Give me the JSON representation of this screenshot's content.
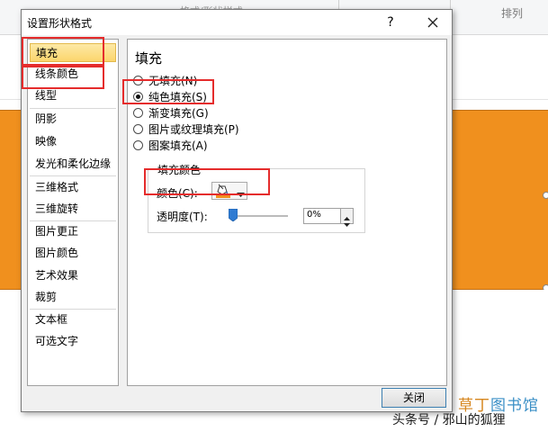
{
  "background": {
    "ribbon_faded_text": "格式/形状样式",
    "arrange_label": "排列",
    "shape_fill_color": "#f0901e"
  },
  "dialog": {
    "title": "设置形状格式",
    "help_label": "?",
    "close_icon": "close-icon",
    "close_button_label": "关闭"
  },
  "sidebar": {
    "items": [
      {
        "label": "填充",
        "selected": true
      },
      {
        "label": "线条颜色",
        "selected": false
      },
      {
        "label": "线型",
        "selected": false
      },
      {
        "label": "阴影",
        "selected": false
      },
      {
        "label": "映像",
        "selected": false
      },
      {
        "label": "发光和柔化边缘",
        "selected": false
      },
      {
        "label": "三维格式",
        "selected": false
      },
      {
        "label": "三维旋转",
        "selected": false
      },
      {
        "label": "图片更正",
        "selected": false
      },
      {
        "label": "图片颜色",
        "selected": false
      },
      {
        "label": "艺术效果",
        "selected": false
      },
      {
        "label": "裁剪",
        "selected": false
      },
      {
        "label": "文本框",
        "selected": false
      },
      {
        "label": "可选文字",
        "selected": false
      }
    ]
  },
  "panel": {
    "title": "填充",
    "options": [
      {
        "label": "无填充(N)",
        "checked": false
      },
      {
        "label": "纯色填充(S)",
        "checked": true
      },
      {
        "label": "渐变填充(G)",
        "checked": false
      },
      {
        "label": "图片或纹理填充(P)",
        "checked": false
      },
      {
        "label": "图案填充(A)",
        "checked": false
      }
    ],
    "fill_color_group": {
      "label": "填充颜色",
      "color_label": "颜色(C):",
      "color_swatch": "#f0901e",
      "transparency_label": "透明度(T):",
      "transparency_value": "0%",
      "transparency_level": 0
    }
  },
  "watermark": {
    "brand_part1": "草丁",
    "brand_part2": "图书馆",
    "credit": "头条号 / 邪山的狐狸"
  }
}
